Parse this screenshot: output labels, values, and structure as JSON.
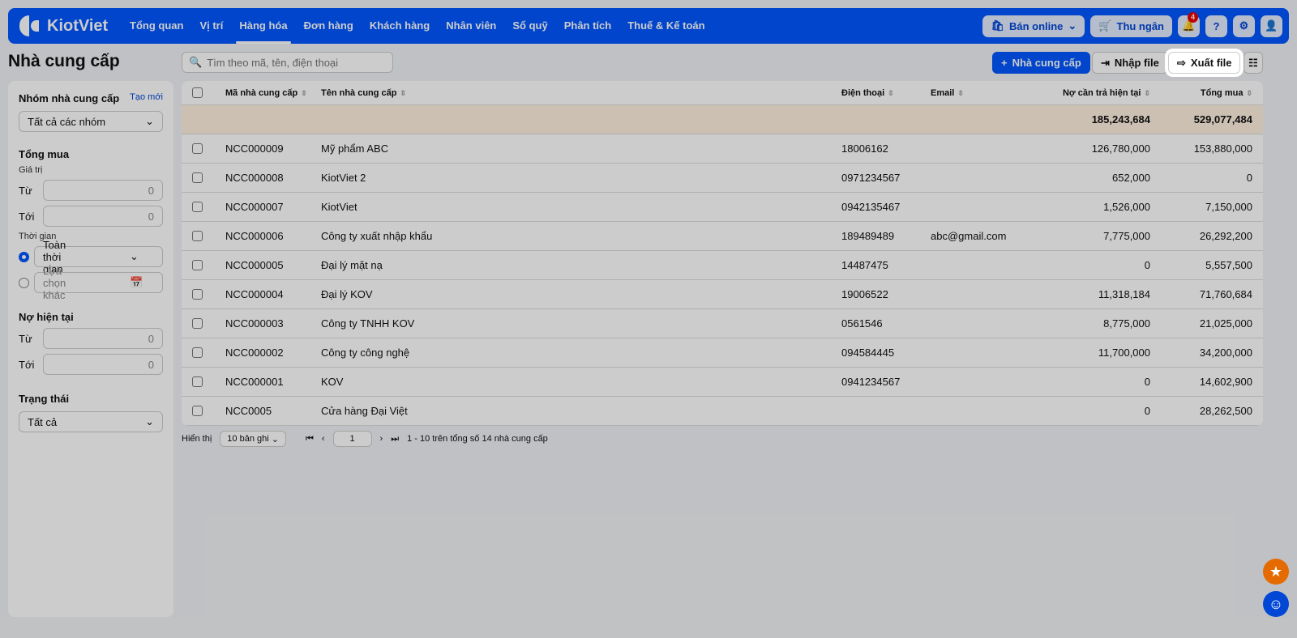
{
  "nav": {
    "brand": "KiotViet",
    "items": [
      "Tổng quan",
      "Vị trí",
      "Hàng hóa",
      "Đơn hàng",
      "Khách hàng",
      "Nhân viên",
      "Sổ quỹ",
      "Phân tích",
      "Thuế & Kế toán"
    ],
    "active": 2,
    "online": "Bán online",
    "cashier": "Thu ngân",
    "notifications": "4"
  },
  "page": {
    "title": "Nhà cung cấp",
    "search_placeholder": "Tìm theo mã, tên, điện thoại",
    "add": "Nhà cung cấp",
    "import": "Nhập file",
    "export": "Xuất file"
  },
  "sidebar": {
    "group_title": "Nhóm nhà cung cấp",
    "group_new": "Tạo mới",
    "group_value": "Tất cả các nhóm",
    "total_title": "Tổng mua",
    "value_label": "Giá trị",
    "from": "Từ",
    "to": "Tới",
    "zero": "0",
    "time_label": "Thời gian",
    "time_all": "Toàn thời gian",
    "time_other": "Lựa chọn khác",
    "debt_title": "Nợ hiện tại",
    "status_title": "Trạng thái",
    "status_value": "Tất cả"
  },
  "table": {
    "headers": [
      "Mã nhà cung cấp",
      "Tên nhà cung cấp",
      "Điện thoại",
      "Email",
      "Nợ cần trả hiện tại",
      "Tổng mua"
    ],
    "summary": {
      "debt": "185,243,684",
      "total": "529,077,484"
    },
    "rows": [
      [
        "NCC000009",
        "Mỹ phẩm ABC",
        "18006162",
        "",
        "126,780,000",
        "153,880,000"
      ],
      [
        "NCC000008",
        "KiotViet 2",
        "0971234567",
        "",
        "652,000",
        "0"
      ],
      [
        "NCC000007",
        "KiotViet",
        "0942135467",
        "",
        "1,526,000",
        "7,150,000"
      ],
      [
        "NCC000006",
        "Công ty xuất nhập khẩu",
        "189489489",
        "abc@gmail.com",
        "7,775,000",
        "26,292,200"
      ],
      [
        "NCC000005",
        "Đại lý mặt nạ",
        "14487475",
        "",
        "0",
        "5,557,500"
      ],
      [
        "NCC000004",
        "Đại lý KOV",
        "19006522",
        "",
        "11,318,184",
        "71,760,684"
      ],
      [
        "NCC000003",
        "Công ty TNHH KOV",
        "0561546",
        "",
        "8,775,000",
        "21,025,000"
      ],
      [
        "NCC000002",
        "Công ty công nghệ",
        "094584445",
        "",
        "11,700,000",
        "34,200,000"
      ],
      [
        "NCC000001",
        "KOV",
        "0941234567",
        "",
        "0",
        "14,602,900"
      ],
      [
        "NCC0005",
        "Cửa hàng Đại Việt",
        "",
        "",
        "0",
        "28,262,500"
      ]
    ]
  },
  "pager": {
    "show": "Hiển thị",
    "per_page": "10 bản ghi",
    "page": "1",
    "summary": "1 - 10 trên tổng số 14 nhà cung cấp"
  }
}
